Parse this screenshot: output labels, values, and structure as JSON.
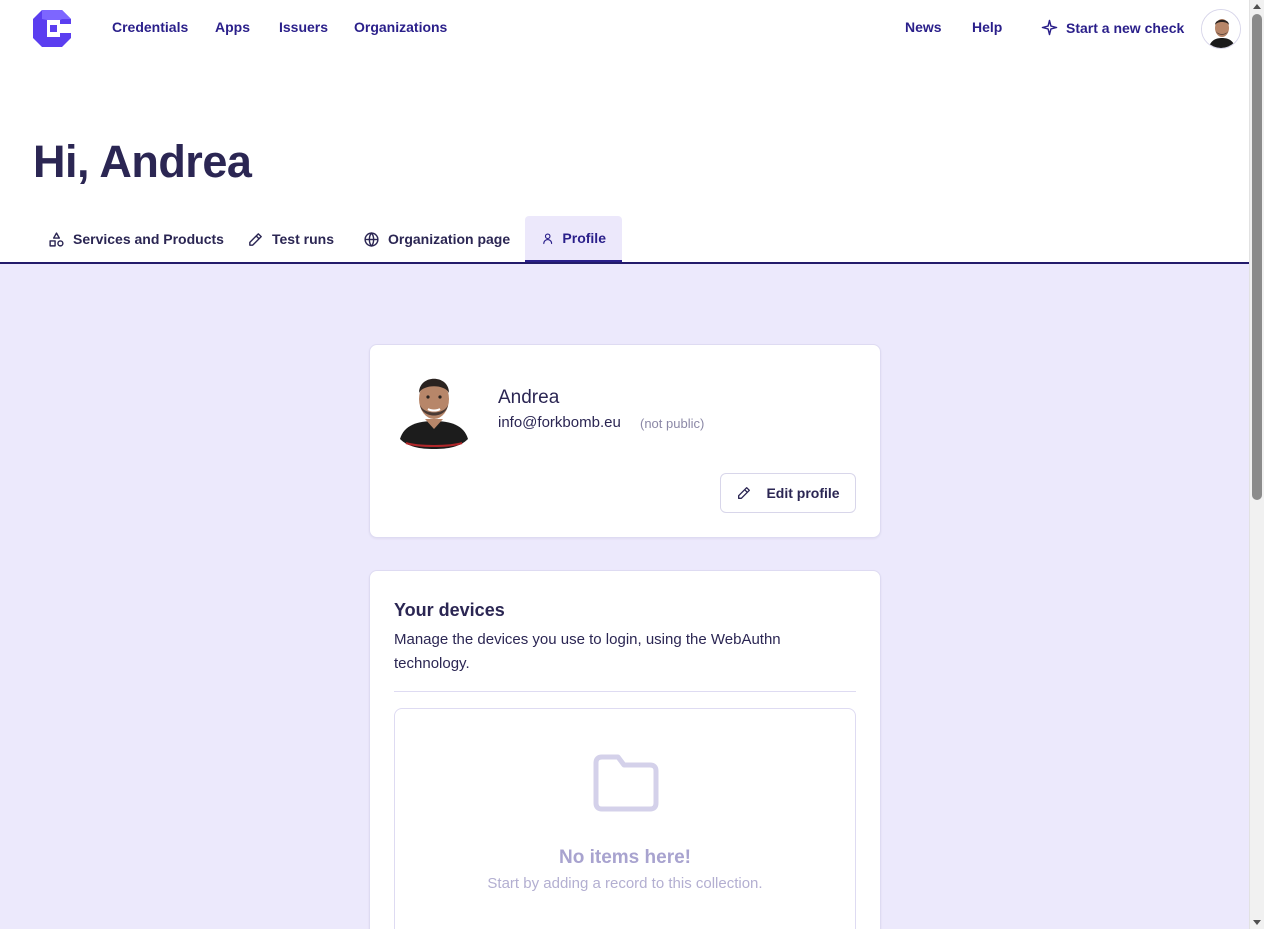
{
  "nav": {
    "logo": "app-logo",
    "links": [
      "Credentials",
      "Apps",
      "Issuers",
      "Organizations"
    ],
    "right_links": [
      "News",
      "Help"
    ],
    "new_check_label": "Start a new check",
    "new_check_icon": "sparkle-icon",
    "avatar": "user-avatar"
  },
  "greeting": "Hi, Andrea",
  "tabs": [
    {
      "label": "Services and Products",
      "icon": "shapes-icon"
    },
    {
      "label": "Test runs",
      "icon": "pencil-icon"
    },
    {
      "label": "Organization page",
      "icon": "globe-icon"
    },
    {
      "label": "Profile",
      "icon": "user-icon",
      "active": true
    }
  ],
  "profile": {
    "name": "Andrea",
    "email": "info@forkbomb.eu",
    "visibility_note": "(not public)",
    "edit_label": "Edit profile"
  },
  "devices": {
    "title": "Your devices",
    "description": "Manage the devices you use to login, using the WebAuthn technology.",
    "empty_title": "No items here!",
    "empty_subtitle": "Start by adding a record to this collection."
  },
  "colors": {
    "accent": "#2a1f8a",
    "page_background": "#ece9fc",
    "logo": "#5b3ef0",
    "heading": "#2b2653"
  }
}
